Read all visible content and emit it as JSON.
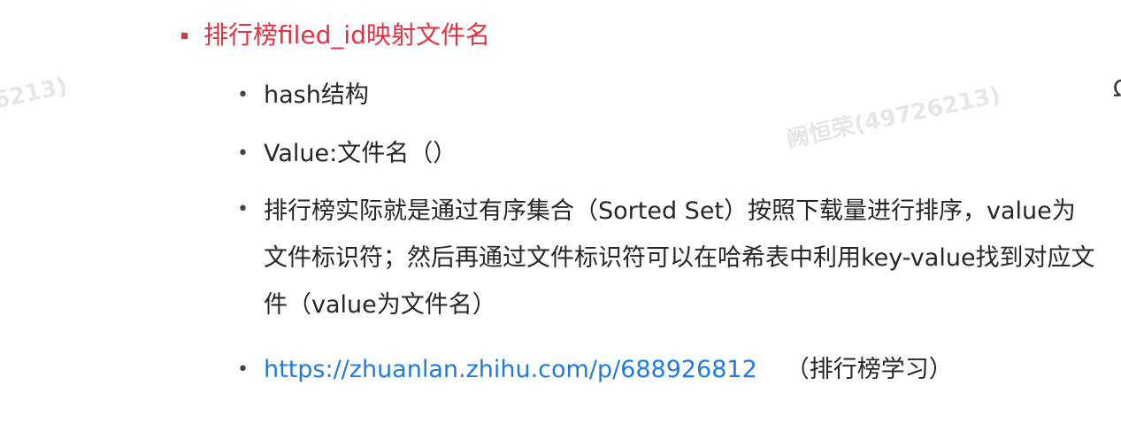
{
  "watermarks": {
    "left": "6213)",
    "center": "阙恒荣(49726213)"
  },
  "edge_glyph": "Ω",
  "heading": {
    "text": "排行榜filed_id映射文件名",
    "color": "#e03244"
  },
  "bullets": [
    {
      "text": "hash结构"
    },
    {
      "text": "Value:文件名（）"
    },
    {
      "text": "排行榜实际就是通过有序集合（Sorted Set）按照下载量进行排序，value为文件标识符；然后再通过文件标识符可以在哈希表中利用key-value找到对应文件（value为文件名）"
    },
    {
      "link": "https://zhuanlan.zhihu.com/p/688926812",
      "note": "（排行榜学习）"
    }
  ],
  "bullet_glyph": "•",
  "link_color": "#1e7be0"
}
